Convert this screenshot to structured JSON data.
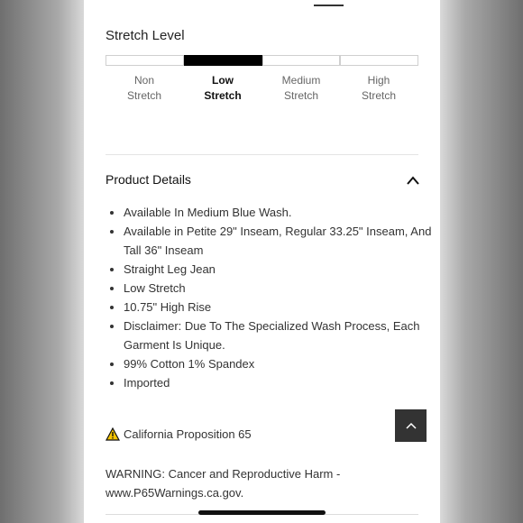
{
  "stretch": {
    "title": "Stretch Level",
    "selected_index": 1,
    "levels": [
      {
        "line1": "Non",
        "line2": "Stretch"
      },
      {
        "line1": "Low",
        "line2": "Stretch"
      },
      {
        "line1": "Medium",
        "line2": "Stretch"
      },
      {
        "line1": "High",
        "line2": "Stretch"
      }
    ]
  },
  "product_details": {
    "title": "Product Details",
    "expanded": true,
    "items": [
      "Available In Medium Blue Wash.",
      "Available in Petite 29\" Inseam, Regular 33.25\" Inseam, And Tall 36\" Inseam",
      "Straight Leg Jean",
      "Low Stretch",
      "10.75\" High Rise",
      "Disclaimer: Due To The Specialized Wash Process, Each Garment Is Unique.",
      "99% Cotton 1% Spandex",
      "Imported"
    ]
  },
  "prop65": {
    "label": "California Proposition 65",
    "warning": "WARNING: Cancer and Reproductive Harm - www.P65Warnings.ca.gov."
  },
  "icons": {
    "collapse": "chevron-up-icon",
    "warning": "warning-triangle-icon",
    "scroll_top": "chevron-up-icon"
  },
  "colors": {
    "active_segment": "#000000",
    "warning_yellow": "#f5c400",
    "scroll_button": "#333333"
  }
}
